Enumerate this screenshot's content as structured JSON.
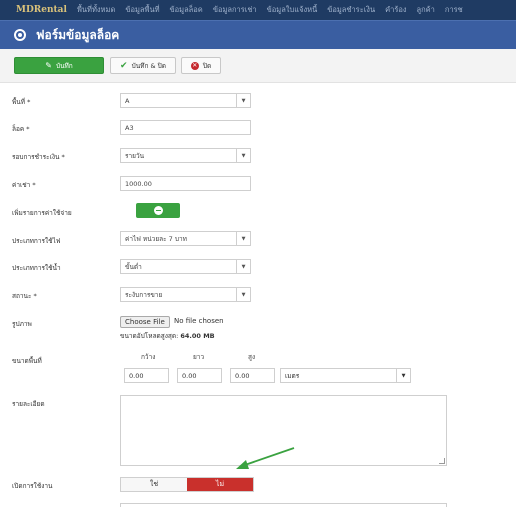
{
  "nav": {
    "brand": "MDRental",
    "items": [
      "พื้นที่ทั้งหมด",
      "ข้อมูลพื้นที่",
      "ข้อมูลล็อค",
      "ข้อมูลการเช่า",
      "ข้อมูลใบแจ้งหนี้",
      "ข้อมูลชำระเงิน",
      "คำร้อง",
      "ลูกค้า",
      "การช"
    ]
  },
  "title": "ฟอร์มข้อมูลล็อค",
  "toolbar": {
    "save_label": "บันทึก",
    "save_close_label": "บันทึก & ปิด",
    "close_label": "ปิด"
  },
  "form": {
    "area_label": "พื้นที่ *",
    "area_value": "A",
    "lock_label": "ล็อค *",
    "lock_value": "A3",
    "billing_cycle_label": "รอบการชำระเงิน *",
    "billing_cycle_value": "รายวัน",
    "rent_label": "ค่าเช่า *",
    "rent_value": "1000.00",
    "add_expense_label": "เพิ่มรายการค่าใช้จ่าย",
    "electric_label": "ประเภทการใช้ไฟ",
    "electric_value": "ค่าไฟ หน่วยละ 7 บาท",
    "water_label": "ประเภทการใช้น้ำ",
    "water_value": "ขั้นต่ำ",
    "status_label": "สถานะ *",
    "status_value": "ระงับการขาย",
    "image_label": "รูปภาพ",
    "choose_file": "Choose File",
    "no_file": "No file chosen",
    "upload_note_prefix": "ขนาดอัปโหลดสูงสุด:",
    "upload_note_size": "64.00 MB",
    "size_label": "ขนาดพื้นที่",
    "width_label": "กว้าง",
    "length_label": "ยาว",
    "height_label": "สูง",
    "width_value": "0.00",
    "length_value": "0.00",
    "height_value": "0.00",
    "unit_value": "เมตร",
    "detail_label": "รายละเอียด",
    "enable_label": "เปิดการใช้งาน",
    "enable_yes": "ใช่",
    "enable_no": "ไม่"
  },
  "colors": {
    "nav_bg": "#1f3b63",
    "title_bg": "#3a5ea1",
    "save_green": "#3aa240",
    "no_red": "#c9302c",
    "arrow_green": "#3aa240"
  }
}
